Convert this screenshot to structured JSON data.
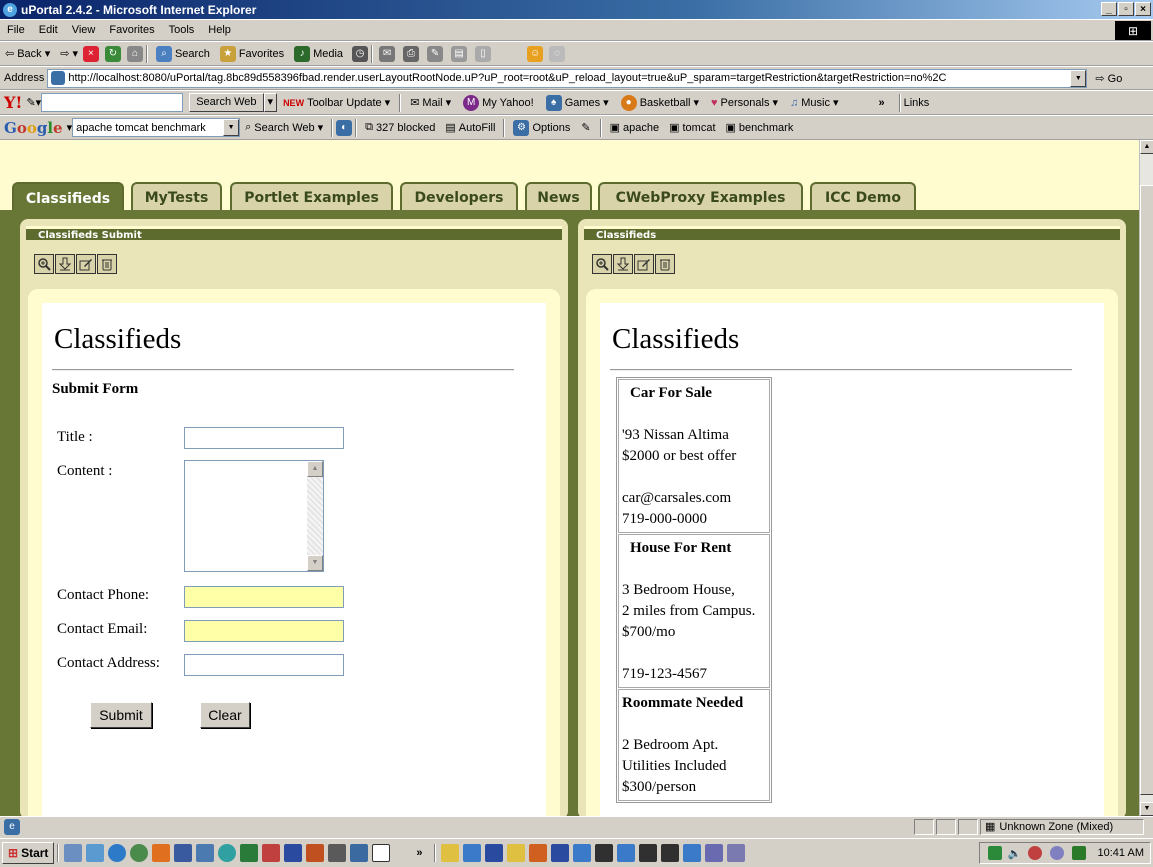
{
  "window": {
    "title": "uPortal 2.4.2 - Microsoft Internet Explorer"
  },
  "menu": [
    "File",
    "Edit",
    "View",
    "Favorites",
    "Tools",
    "Help"
  ],
  "toolbar": {
    "back": "Back",
    "search": "Search",
    "favorites": "Favorites",
    "media": "Media"
  },
  "address": {
    "label": "Address",
    "url": "http://localhost:8080/uPortal/tag.8bc89d558396fbad.render.userLayoutRootNode.uP?uP_root=root&uP_reload_layout=true&uP_sparam=targetRestriction&targetRestriction=no%2C",
    "go": "Go"
  },
  "yahoo": {
    "search_web": "Search Web",
    "new_badge": "NEW",
    "toolbar_update": "Toolbar Update",
    "mail": "Mail",
    "my_yahoo": "My Yahoo!",
    "games": "Games",
    "basketball": "Basketball",
    "personals": "Personals",
    "music": "Music",
    "more": "»",
    "links": "Links"
  },
  "google": {
    "logo": "Google",
    "query": "apache tomcat benchmark",
    "search_web": "Search Web",
    "blocked": "327 blocked",
    "autofill": "AutoFill",
    "options": "Options",
    "terms": [
      "apache",
      "tomcat",
      "benchmark"
    ]
  },
  "tabs": [
    "Classifieds",
    "MyTests",
    "Portlet Examples",
    "Developers",
    "News",
    "CWebProxy Examples",
    "ICC Demo"
  ],
  "left_channel": {
    "header": "Classifieds Submit",
    "title": "Classifieds",
    "form_heading": "Submit Form",
    "labels": {
      "title": "Title :",
      "content": "Content :",
      "phone": "Contact Phone:",
      "email": "Contact Email:",
      "address": "Contact Address:"
    },
    "buttons": {
      "submit": "Submit",
      "clear": "Clear"
    }
  },
  "right_channel": {
    "header": "Classifieds",
    "title": "Classifieds",
    "ads": [
      {
        "heading": "Car For Sale",
        "lines": [
          "'93 Nissan Altima",
          "$2000 or best offer",
          "",
          "car@carsales.com",
          "719-000-0000"
        ]
      },
      {
        "heading": "House For Rent",
        "lines": [
          "3 Bedroom House,",
          "2 miles from Campus.",
          "$700/mo",
          "",
          "719-123-4567"
        ]
      },
      {
        "heading": "Roommate Needed",
        "lines": [
          "2 Bedroom Apt.",
          "Utilities Included",
          "$300/person"
        ]
      }
    ]
  },
  "status": {
    "zone": "Unknown Zone (Mixed)"
  },
  "taskbar": {
    "start": "Start",
    "clock": "10:41 AM"
  }
}
